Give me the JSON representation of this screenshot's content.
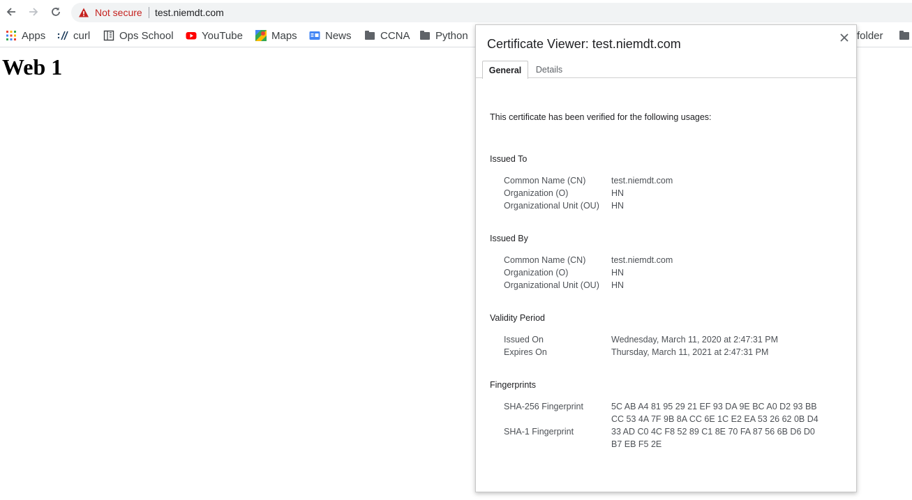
{
  "omnibox": {
    "security_label": "Not secure",
    "url": "test.niemdt.com"
  },
  "bookmarks": {
    "items": [
      {
        "label": "Apps",
        "icon": "apps-grid-icon"
      },
      {
        "label": "curl",
        "icon": "curl-icon"
      },
      {
        "label": "Ops School",
        "icon": "ops-school-icon"
      },
      {
        "label": "YouTube",
        "icon": "youtube-icon"
      },
      {
        "label": "Maps",
        "icon": "maps-icon"
      },
      {
        "label": "News",
        "icon": "news-icon"
      },
      {
        "label": "CCNA",
        "icon": "folder-icon"
      },
      {
        "label": "Python",
        "icon": "folder-icon"
      }
    ],
    "other_folder_label": "folder"
  },
  "page": {
    "heading": "Web 1"
  },
  "dialog": {
    "title": "Certificate Viewer: test.niemdt.com",
    "tabs": [
      {
        "label": "General",
        "active": true
      },
      {
        "label": "Details",
        "active": false
      }
    ],
    "intro": "This certificate has been verified for the following usages:",
    "issued_to": {
      "heading": "Issued To",
      "rows": [
        {
          "label": "Common Name (CN)",
          "value": "test.niemdt.com"
        },
        {
          "label": "Organization (O)",
          "value": "HN"
        },
        {
          "label": "Organizational Unit (OU)",
          "value": "HN"
        }
      ]
    },
    "issued_by": {
      "heading": "Issued By",
      "rows": [
        {
          "label": "Common Name (CN)",
          "value": "test.niemdt.com"
        },
        {
          "label": "Organization (O)",
          "value": "HN"
        },
        {
          "label": "Organizational Unit (OU)",
          "value": "HN"
        }
      ]
    },
    "validity": {
      "heading": "Validity Period",
      "rows": [
        {
          "label": "Issued On",
          "value": "Wednesday, March 11, 2020 at 2:47:31 PM"
        },
        {
          "label": "Expires On",
          "value": "Thursday, March 11, 2021 at 2:47:31 PM"
        }
      ]
    },
    "fingerprints": {
      "heading": "Fingerprints",
      "sha256_label": "SHA-256 Fingerprint",
      "sha256_line1": "5C AB A4 81 95 29 21 EF 93 DA 9E BC A0 D2 93 BB",
      "sha256_line2": "CC 53 4A 7F 9B 8A CC 6E 1C E2 EA 53 26 62 0B D4",
      "sha1_label": "SHA-1 Fingerprint",
      "sha1_line1": "33 AD C0 4C F8 52 89 C1 8E 70 FA 87 56 6B D6 D0",
      "sha1_line2": "B7 EB F5 2E"
    }
  },
  "colors": {
    "not_secure": "#c5221f",
    "youtube_red": "#ff0000",
    "apps_grid": [
      "#ea4335",
      "#fbbc04",
      "#34a853",
      "#4285f4"
    ]
  }
}
